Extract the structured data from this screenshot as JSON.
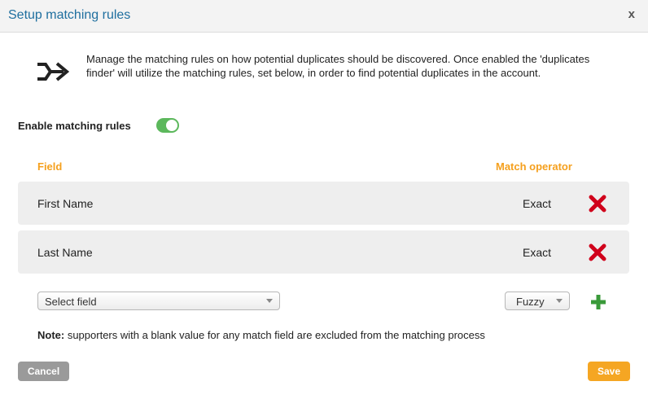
{
  "dialog": {
    "title": "Setup matching rules",
    "close_label": "x"
  },
  "intro": {
    "icon": "merge-arrow-icon",
    "text": "Manage the matching rules on how potential duplicates should be discovered. Once enabled the 'duplicates finder' will utilize the matching rules, set below, in order to find potential duplicates in the account."
  },
  "enable": {
    "label": "Enable matching rules",
    "enabled": true
  },
  "columns": {
    "field": "Field",
    "operator": "Match operator"
  },
  "rules": [
    {
      "field": "First Name",
      "operator": "Exact"
    },
    {
      "field": "Last Name",
      "operator": "Exact"
    }
  ],
  "new_rule": {
    "field_value": "Select field",
    "operator_value": "Fuzzy"
  },
  "note": {
    "label": "Note:",
    "text": " supporters with a blank value for any match field are excluded from the matching process"
  },
  "buttons": {
    "cancel": "Cancel",
    "save": "Save"
  },
  "colors": {
    "title": "#1f6f9f",
    "accent": "#f5a01e",
    "toggle_on": "#5cb85c",
    "delete": "#d0021b",
    "add": "#3a9a3a"
  }
}
